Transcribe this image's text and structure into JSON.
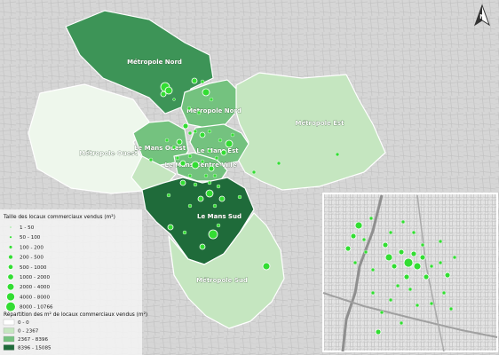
{
  "north_arrow": {
    "label": "N"
  },
  "zones": [
    {
      "id": "metropole-nord",
      "label": "Métropole Nord",
      "fill": "#3d9457"
    },
    {
      "id": "metropole-nord-2",
      "label": "Métropole Nord",
      "fill": "#74c27f"
    },
    {
      "id": "metropole-est",
      "label": "Métropole Est",
      "fill": "#c5e6c0"
    },
    {
      "id": "metropole-ouest",
      "label": "Métropole Ouest",
      "fill": "#eef7ec"
    },
    {
      "id": "le-mans-ouest",
      "label": "Le Mans Ouest",
      "fill": "#74c27f"
    },
    {
      "id": "le-mans-est",
      "label": "Le Mans Est",
      "fill": "#74c27f"
    },
    {
      "id": "le-mans-centre-ville",
      "label": "Le Mans Centre-Ville",
      "fill": "#74c27f"
    },
    {
      "id": "le-mans-sud",
      "label": "Le Mans Sud",
      "fill": "#1f6b3a"
    },
    {
      "id": "metropole-sud",
      "label": "Métropole Sud",
      "fill": "#c5e6c0"
    }
  ],
  "legend_size": {
    "title": "Taille des locaux commerciaux vendus (m²)",
    "items": [
      "1 - 50",
      "50 - 100",
      "100 - 200",
      "200 - 500",
      "500 - 1000",
      "1000 - 2000",
      "2000 - 4000",
      "4000 - 8000",
      "8000 - 10766"
    ]
  },
  "legend_choropleth": {
    "title": "Répartition des m² de locaux commerciaux vendus (m²)",
    "items": [
      {
        "label": "0 - 0",
        "color": "#ffffff"
      },
      {
        "label": "0 - 2367",
        "color": "#c5e6c0"
      },
      {
        "label": "2367 - 8396",
        "color": "#74c27f"
      },
      {
        "label": "8396 - 15085",
        "color": "#1f6b3a"
      }
    ]
  },
  "point_color": "#33dd33",
  "inset": {
    "name": "Le Mans centre-ville zoom"
  }
}
